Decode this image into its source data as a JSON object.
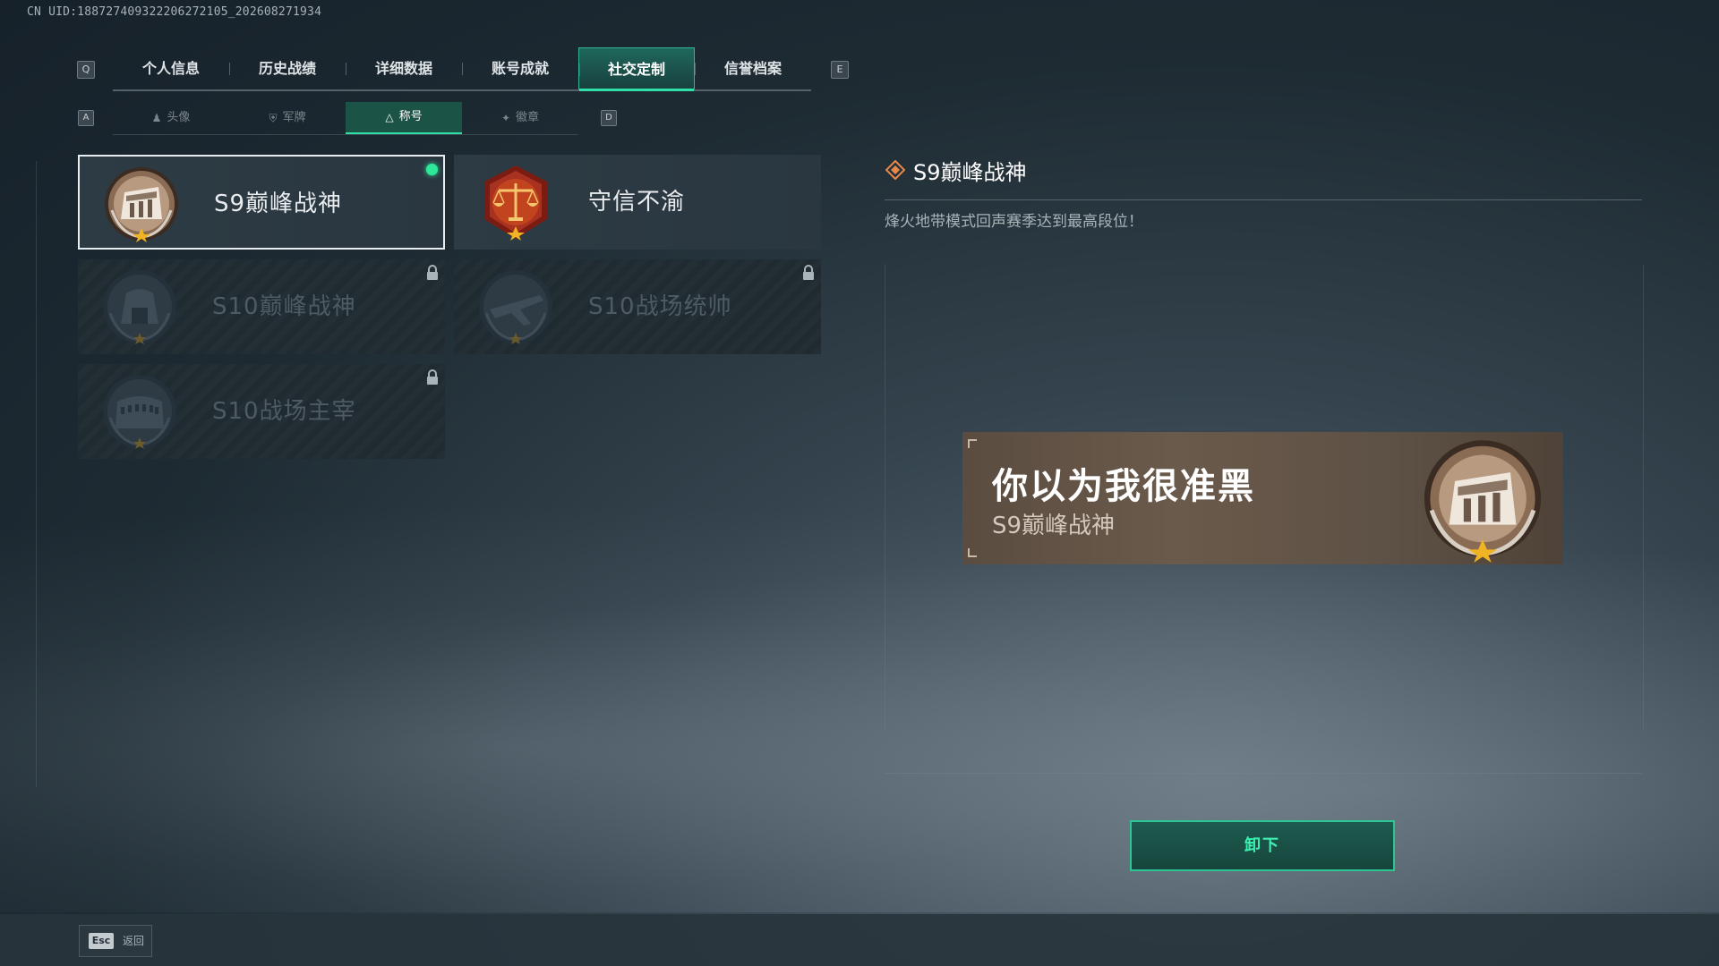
{
  "uid": "CN UID:188727409322206272105_202608271934",
  "main_tabs": {
    "key_left": "Q",
    "key_right": "E",
    "items": [
      {
        "label": "个人信息"
      },
      {
        "label": "历史战绩"
      },
      {
        "label": "详细数据"
      },
      {
        "label": "账号成就"
      },
      {
        "label": "社交定制",
        "active": true
      },
      {
        "label": "信誉档案"
      }
    ]
  },
  "sub_tabs": {
    "key_left": "A",
    "key_right": "D",
    "items": [
      {
        "label": "头像",
        "icon": "person-icon"
      },
      {
        "label": "军牌",
        "icon": "shield-icon"
      },
      {
        "label": "称号",
        "icon": "triangle-icon",
        "active": true
      },
      {
        "label": "徽章",
        "icon": "wings-icon"
      }
    ]
  },
  "titles": [
    {
      "name": "S9巅峰战神",
      "state": "unlocked",
      "selected": true,
      "equipped": true,
      "badge": "bronze-monument-badge"
    },
    {
      "name": "守信不渝",
      "state": "unlocked",
      "badge": "scales-badge"
    },
    {
      "name": "S10巅峰战神",
      "state": "locked",
      "badge": "monument-badge"
    },
    {
      "name": "S10战场统帅",
      "state": "locked",
      "badge": "aircraft-badge"
    },
    {
      "name": "S10战场主宰",
      "state": "locked",
      "badge": "colosseum-badge"
    }
  ],
  "detail": {
    "title": "S9巅峰战神",
    "description": "烽火地带模式回声赛季达到最高段位！"
  },
  "preview": {
    "main_text": "你以为我很准黑",
    "title_text": "S9巅峰战神"
  },
  "action_button": {
    "label": "卸下"
  },
  "footer": {
    "esc_key": "Esc",
    "esc_label": "返回"
  },
  "colors": {
    "accent": "#2fe0a8",
    "equipped_dot": "#2ee89a",
    "plate_bg": "#6a5a4b"
  }
}
